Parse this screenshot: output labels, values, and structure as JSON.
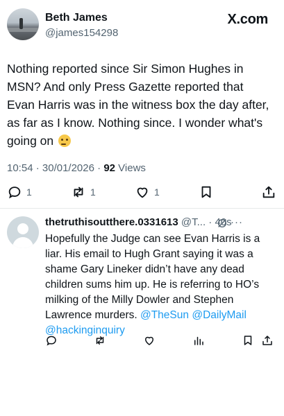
{
  "tweet": {
    "author_name": "Beth James",
    "author_handle": "@james154298",
    "brand": "X.com",
    "text": "Nothing reported since Sir Simon Hughes in MSN? And only Press Gazette reported that Evan Harris was in the witness box the day after, as far as I know. Nothing since. I wonder what's going on",
    "emoji": "thinking-face",
    "time": "10:54",
    "date": "30/01/2026",
    "views_count": "92",
    "views_label": "Views",
    "actions": {
      "reply_count": "1",
      "retweet_count": "1",
      "like_count": "1"
    }
  },
  "reply": {
    "author_name": "thetruthisoutthere.0331613",
    "author_handle": "@T...",
    "time_ago": "40s",
    "text": "Hopefully the Judge can see Evan Harris is a liar.  His email to Hugh Grant saying it was a shame Gary Lineker didn’t have any dead children sums him up.  He is referring to HO’s milking of the Milly Dowler and Stephen Lawrence murders. ",
    "mention_1": "@TheSun",
    "mention_2": "@DailyMail",
    "mention_3": "@hackinginquiry"
  },
  "colors": {
    "text": "#0f1419",
    "secondary": "#536471",
    "link": "#1d9bf0",
    "divider": "#e7e9ea"
  }
}
